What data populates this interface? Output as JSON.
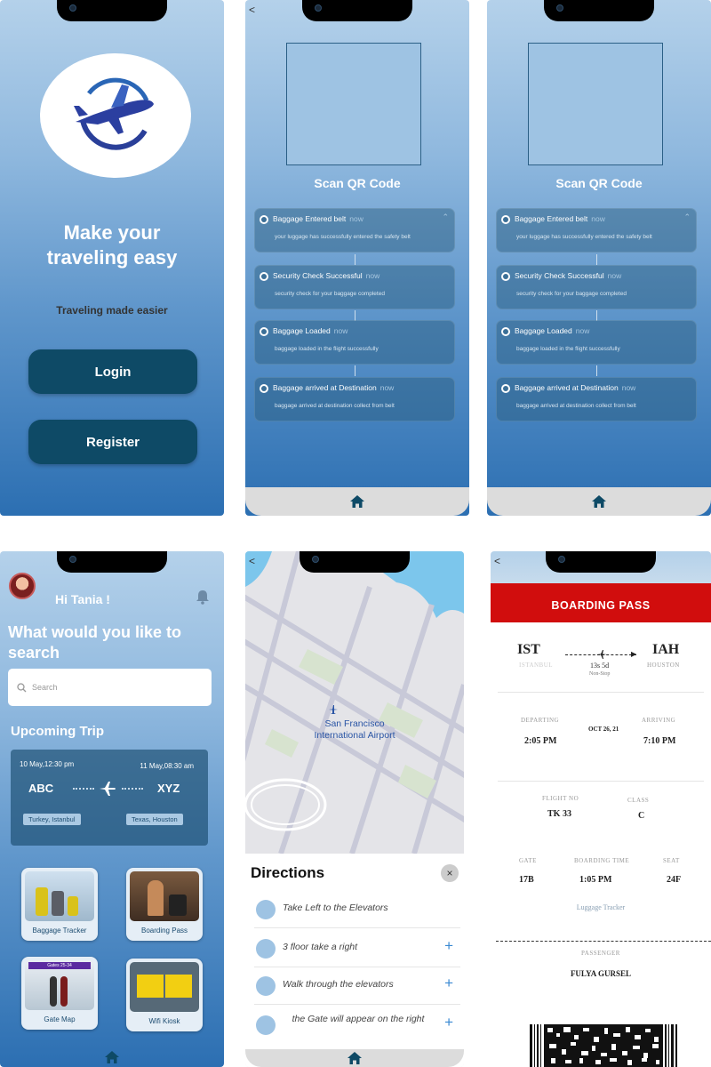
{
  "welcome": {
    "title_line1": "Make your",
    "title_line2": "traveling easy",
    "subtitle": "Traveling made easier",
    "login_label": "Login",
    "register_label": "Register"
  },
  "tracker": {
    "back": "<",
    "scan_title": "Scan QR Code",
    "events": [
      {
        "title": "Baggage Entered belt",
        "time": "now",
        "desc": "your luggage has successfully entered the safety belt"
      },
      {
        "title": "Security  Check  Successful",
        "time": "now",
        "desc": "security check for your baggage completed"
      },
      {
        "title": "Baggage Loaded",
        "time": "now",
        "desc": "baggage loaded in the flight successfully"
      },
      {
        "title": "Baggage arrived at Destination",
        "time": "now",
        "desc": "baggage arrived at destination collect from belt"
      }
    ]
  },
  "dashboard": {
    "greeting": "Hi Tania !",
    "question": "What would you like to search",
    "search_placeholder": "Search",
    "upcoming_title": "Upcoming Trip",
    "trip": {
      "depart_time": "10 May,12:30 pm",
      "arrive_time": "11 May,08:30 am",
      "from_code": "ABC",
      "to_code": "XYZ",
      "from_city": "Turkey, Istanbul",
      "to_city": "Texas, Houston"
    },
    "tiles": [
      "Baggage Tracker",
      "Boarding Pass",
      "Gate Map",
      "Wifi Kiosk"
    ],
    "gate_sign": "Gates 25-34"
  },
  "map": {
    "back": "<",
    "airport_line1": "San Francisco",
    "airport_line2": "International Airport",
    "directions_title": "Directions",
    "close": "×",
    "steps": [
      "Take Left to the Elevators",
      "3 floor take a right",
      "Walk through the elevators",
      "the Gate will appear on the right"
    ],
    "plus": "+"
  },
  "boarding_pass": {
    "back": "<",
    "header": "BOARDING PASS",
    "from_code": "IST",
    "from_city": "ISTANBUL",
    "to_code": "IAH",
    "to_city": "HOUSTON",
    "duration": "13s 5d",
    "stops": "Non-Stop",
    "departing_label": "DEPARTING",
    "departing": "2:05 PM",
    "date": "OCT 26, 21",
    "arriving_label": "ARRIVING",
    "arriving": "7:10 PM",
    "flight_label": "FLIGHT NO",
    "flight": "TK 33",
    "class_label": "CLASS",
    "class": "C",
    "gate_label": "GATE",
    "gate": "17B",
    "boarding_label": "BOARDING TIME",
    "boarding": "1:05 PM",
    "seat_label": "SEAT",
    "seat": "24F",
    "luggage_link": "Luggage Tracker",
    "passenger_label": "PASSENGER",
    "passenger": "FULYA GURSEL"
  },
  "colors": {
    "primary_dark": "#0e4a66",
    "boarding_red": "#d10d0d",
    "accent_blue": "#3a89d2"
  }
}
